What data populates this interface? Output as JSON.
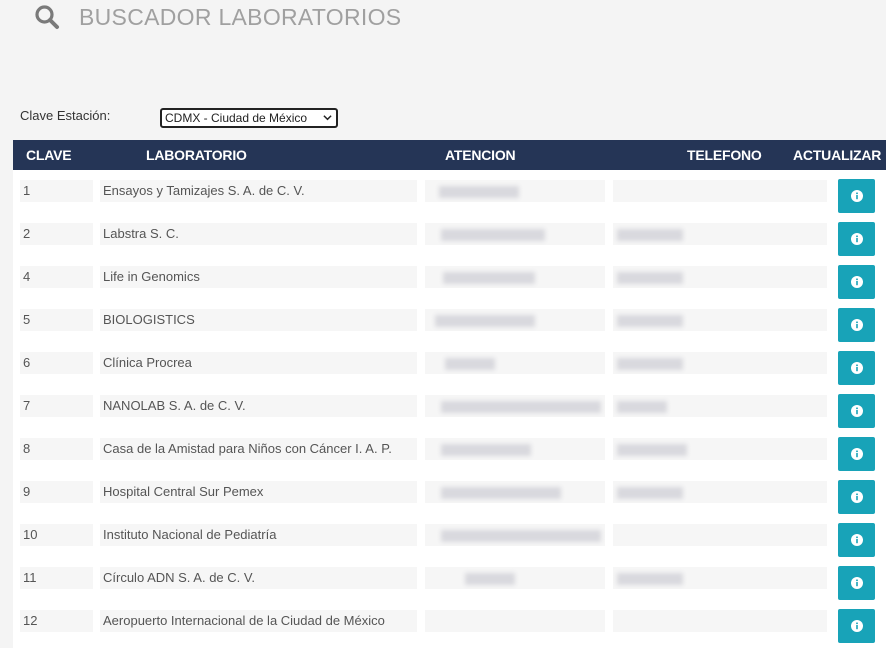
{
  "header": {
    "title": "BUSCADOR LABORATORIOS",
    "icon": "search-icon"
  },
  "filter": {
    "label": "Clave Estación:",
    "selected": "CDMX - Ciudad de México"
  },
  "table": {
    "columns": [
      "CLAVE",
      "LABORATORIO",
      "ATENCION",
      "TELEFONO",
      "ACTUALIZAR"
    ],
    "action_icon": "info-icon",
    "action_color": "#18a3b8",
    "header_color": "#253556",
    "rows": [
      {
        "clave": "1",
        "laboratorio": "Ensayos y Tamizajes S. A. de C. V."
      },
      {
        "clave": "2",
        "laboratorio": "Labstra S. C."
      },
      {
        "clave": "4",
        "laboratorio": "Life in Genomics"
      },
      {
        "clave": "5",
        "laboratorio": " BIOLOGISTICS"
      },
      {
        "clave": "6",
        "laboratorio": "Clínica Procrea"
      },
      {
        "clave": "7",
        "laboratorio": "NANOLAB S. A. de C. V."
      },
      {
        "clave": "8",
        "laboratorio": "Casa de la Amistad para Niños con Cáncer I. A. P."
      },
      {
        "clave": "9",
        "laboratorio": "Hospital Central Sur Pemex"
      },
      {
        "clave": "10",
        "laboratorio": "Instituto Nacional de Pediatría"
      },
      {
        "clave": "11",
        "laboratorio": "Círculo ADN S. A. de C. V."
      },
      {
        "clave": "12",
        "laboratorio": "Aeropuerto Internacional de la Ciudad de México"
      }
    ]
  }
}
